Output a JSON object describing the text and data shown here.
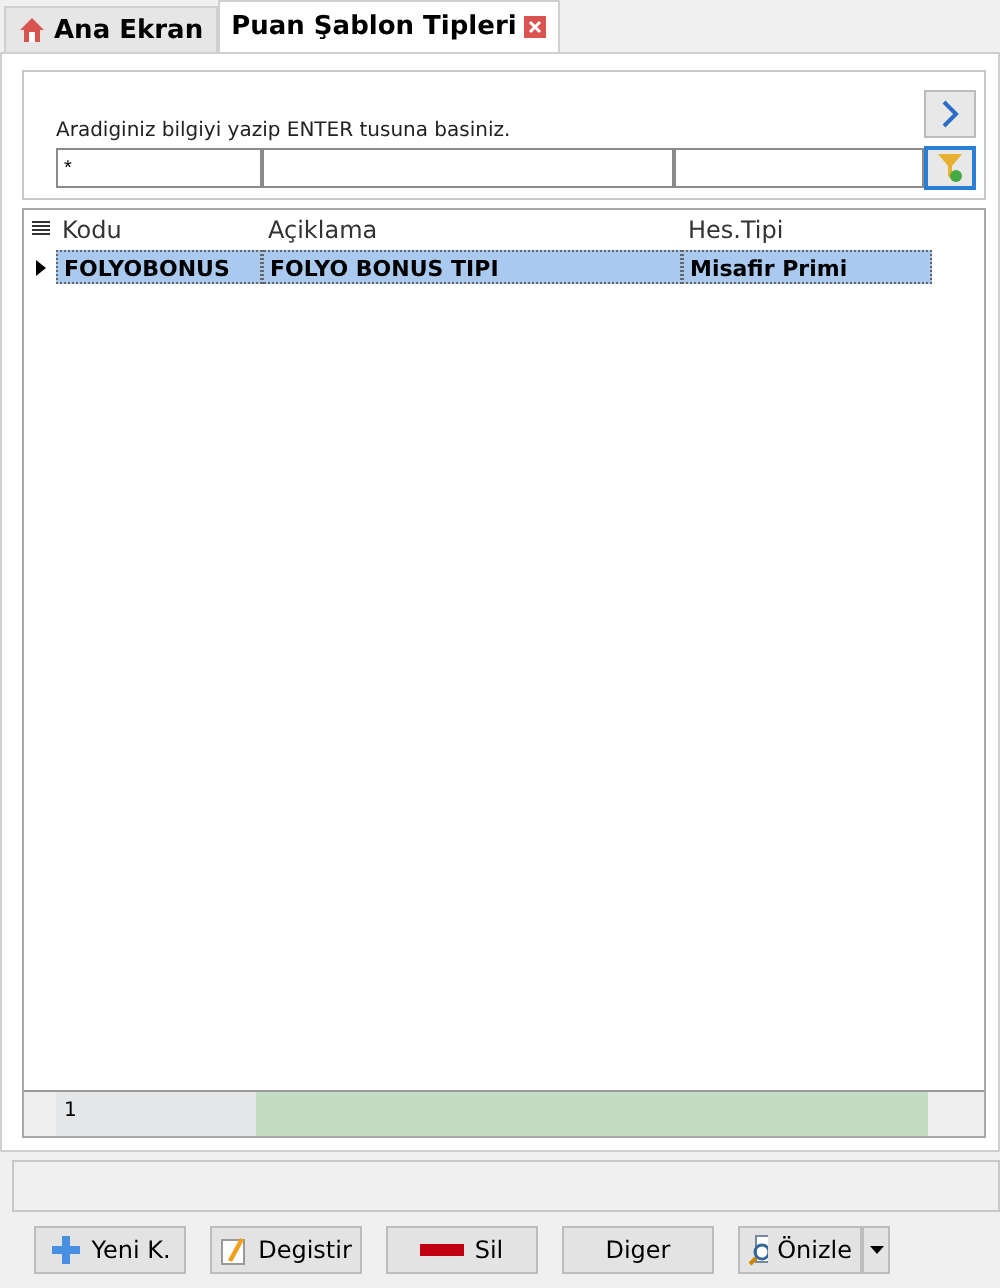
{
  "tabs": [
    {
      "label": "Ana Ekran",
      "kind": "home",
      "selected": false
    },
    {
      "label": "Puan Şablon Tipleri",
      "kind": "closable",
      "selected": true
    }
  ],
  "search": {
    "hint": "Aradiginiz bilgiyi yazip ENTER tusuna basiniz.",
    "first_field_value": "*"
  },
  "table": {
    "columns": [
      "Kodu",
      "Açiklama",
      "Hes.Tipi"
    ],
    "rows": [
      {
        "cells": [
          "FOLYOBONUS",
          "FOLYO BONUS TIPI",
          "Misafir Primi"
        ],
        "selected": true
      }
    ]
  },
  "footer_count": "1",
  "buttons": [
    {
      "label": "Yeni K.",
      "kind": "add"
    },
    {
      "label": "Degistir",
      "kind": "edit"
    },
    {
      "label": "Sil",
      "kind": "delete"
    },
    {
      "label": "Diger",
      "kind": "plain"
    },
    {
      "label": "Önizle",
      "kind": "preview"
    }
  ]
}
